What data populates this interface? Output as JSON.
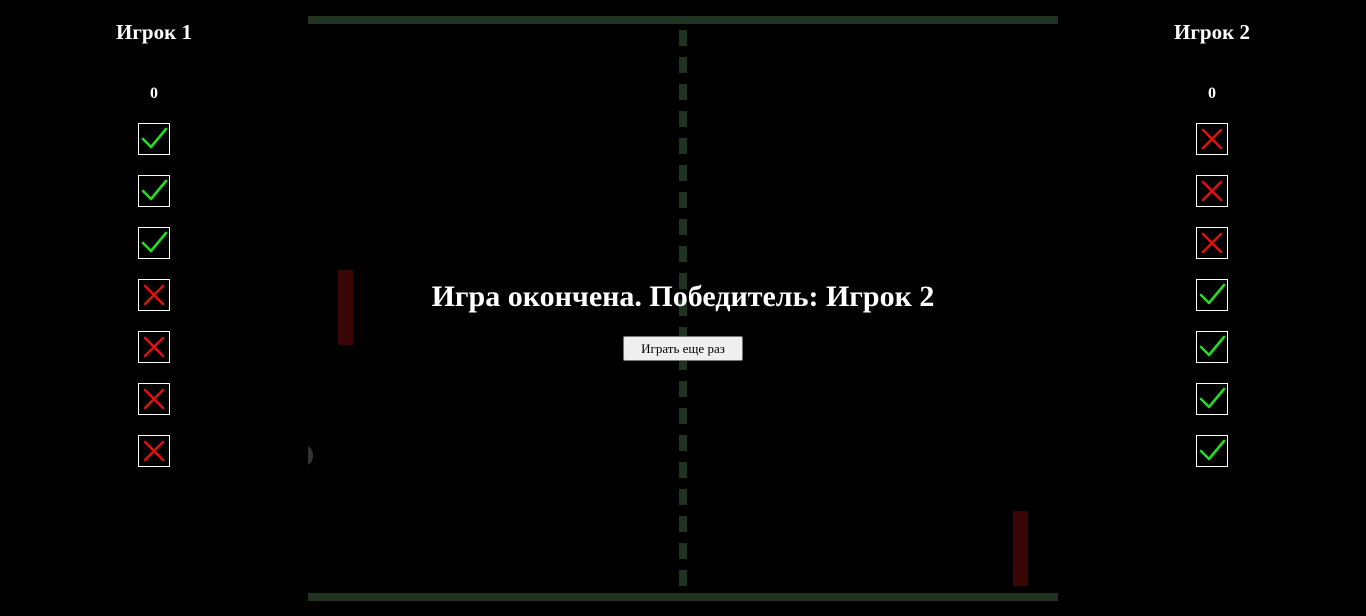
{
  "colors": {
    "background": "#000000",
    "wall": "#1f3320",
    "paddle": "#3a0606",
    "win": "#22dd22",
    "loss": "#dd1111"
  },
  "player1": {
    "name": "Игрок 1",
    "score": "0",
    "rounds": [
      "check-icon",
      "check-icon",
      "check-icon",
      "cross-icon",
      "cross-icon",
      "cross-icon",
      "cross-icon"
    ]
  },
  "player2": {
    "name": "Игрок 2",
    "score": "0",
    "rounds": [
      "cross-icon",
      "cross-icon",
      "cross-icon",
      "check-icon",
      "check-icon",
      "check-icon",
      "check-icon"
    ]
  },
  "overlay": {
    "message": "Игра окончена. Победитель: Игрок 2",
    "button_label": "Играть еще раз"
  }
}
